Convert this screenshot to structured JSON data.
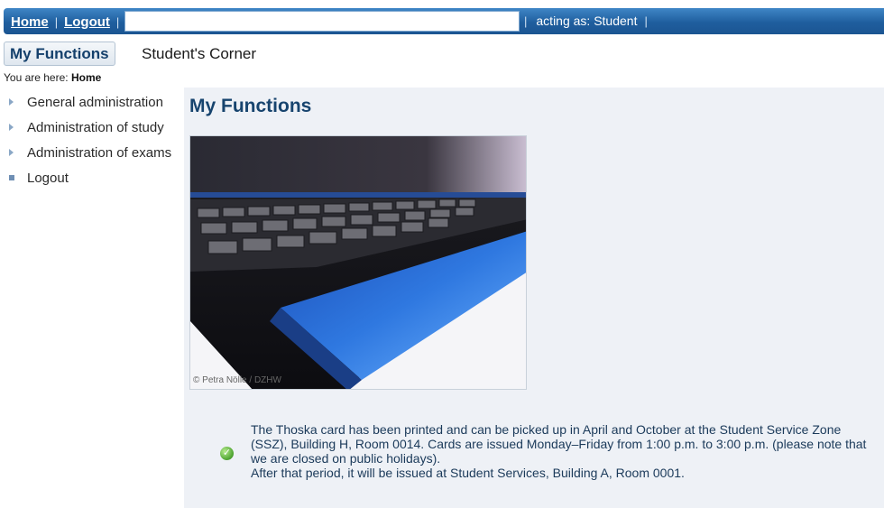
{
  "topbar": {
    "home": "Home",
    "logout": "Logout",
    "search_value": "",
    "role_text": "acting as: Student"
  },
  "tabs": [
    {
      "label": "My Functions",
      "active": true
    },
    {
      "label": "Student's Corner",
      "active": false
    }
  ],
  "breadcrumb": {
    "prefix": "You are here: ",
    "current": "Home"
  },
  "sidebar": {
    "items": [
      {
        "label": "General administration",
        "icon": "triangle-bullet"
      },
      {
        "label": "Administration of study",
        "icon": "triangle-bullet"
      },
      {
        "label": "Administration of exams",
        "icon": "triangle-bullet"
      },
      {
        "label": "Logout",
        "icon": "square-bullet"
      }
    ]
  },
  "main": {
    "title": "My Functions",
    "image": {
      "subject": "keyboard-photo",
      "credit": "© Petra Nölle / DZHW"
    },
    "notice": {
      "icon": "checkmark-icon",
      "line1": "The Thoska card has been printed and can be picked up in April and October at the Student Service Zone (SSZ), Building H, Room 0014. Cards are issued Monday–Friday from 1:00 p.m. to 3:00 p.m. (please note that we are closed on public holidays).",
      "line2": "After that period, it will be issued at Student Services, Building A, Room 0001."
    }
  },
  "colors": {
    "topbar": "#1f5e9e",
    "accent": "#17446e",
    "content_bg": "#eef1f6",
    "ok_green": "#4ca22f"
  }
}
